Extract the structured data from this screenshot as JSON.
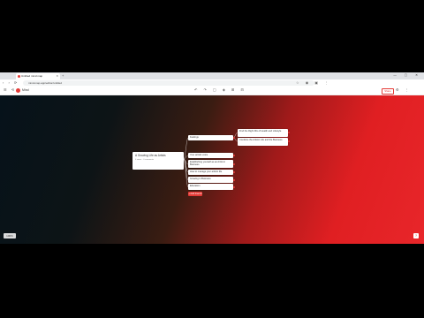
{
  "browser": {
    "tab_title": "Untitled mind map",
    "url": "mind-map.app/editor/untitled",
    "window_controls": "— ▢ ✕"
  },
  "app": {
    "name": "Mind",
    "share_label": "Share"
  },
  "central_node": {
    "title": "A Growing Life as Artists",
    "meta": "0 views · 0 comments"
  },
  "branches": [
    {
      "label": "Feelings",
      "children": [
        {
          "label": "Find the Right Mix of Health and Lifestyle"
        },
        {
          "label": "Combine the Artistic Life and the Business"
        }
      ]
    },
    {
      "label": "Your artistic voice"
    },
    {
      "label": "Establishing yourself as an Artist in Business"
    },
    {
      "label": "How to manage your artistic life"
    },
    {
      "label": "Growing in Business"
    },
    {
      "label": "Education"
    }
  ],
  "add_branch_label": "+ Add branch",
  "zoom_label": "100%"
}
